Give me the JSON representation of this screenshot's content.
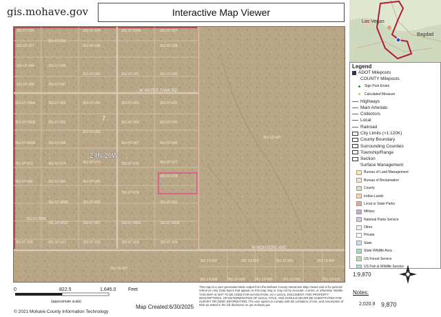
{
  "header": {
    "site": "gis.mohave.gov",
    "title": "Interactive Map Viewer"
  },
  "inset": {
    "city_label": "Las Vegas",
    "town_label": "Bagdad"
  },
  "map": {
    "township": "24N 20W",
    "roads": {
      "water_tank": "W WATER TANK RD",
      "montere": "W MONTERE AVE"
    },
    "parcels": [
      "351-07-024",
      "351-07-028",
      "351-07-028A",
      "351-07-027",
      "351-07-037",
      "351-07-036",
      "351-07-038",
      "351-07-039",
      "351-07-044",
      "351-07-045",
      "351-07-042",
      "351-07-041",
      "351-07-040",
      "351-07-046",
      "351-07-047",
      "351-07-056A",
      "351-07-055",
      "351-07-054",
      "351-07-053",
      "351-07-052",
      "351-07-056B",
      "351-07-062",
      "351-07-063",
      "351-07-064",
      "351-07-065",
      "351-07-069A",
      "351-07-068",
      "351-07-067",
      "351-07-066",
      "351-07-073",
      "351-07-074",
      "351-07-075",
      "351-07-076",
      "351-07-077",
      "351-07-082",
      "351-07-081",
      "351-07-080",
      "351-07-079",
      "351-07-078",
      "351-07-089B",
      "351-07-090",
      "351-07-091",
      "351-07-089A",
      "351-07-089C",
      "351-07-091",
      "351-07-092A",
      "351-07-092B",
      "351-07-100",
      "351-07-101",
      "351-07-102",
      "351-07-103",
      "351-07-104",
      "351-03-007",
      "351-03-007",
      "351-13-007",
      "351-13-008",
      "351-13-009",
      "351-13-001",
      "351-13-004",
      "351-13-006",
      "351-13-005",
      "351-13-003",
      "351-13-010"
    ],
    "lot_number": "7"
  },
  "legend": {
    "title": "Legend",
    "rows": [
      {
        "label": "ADOT Mileposts",
        "kind": "box-dark"
      },
      {
        "label": "COUNTY Mileposts",
        "kind": "none"
      },
      {
        "label": "Sign Post Exists",
        "kind": "dot",
        "color": "#3a8a3a",
        "small": true
      },
      {
        "label": "Calculated Measure",
        "kind": "dot",
        "color": "#d6c24a",
        "small": true
      },
      {
        "label": "Highways",
        "kind": "line"
      },
      {
        "label": "Main Arterials",
        "kind": "line"
      },
      {
        "label": "Collectors",
        "kind": "line"
      },
      {
        "label": "Local",
        "kind": "line"
      },
      {
        "label": "Railroad",
        "kind": "line"
      },
      {
        "label": "City Limits (>1:120K)",
        "kind": "box"
      },
      {
        "label": "County Boundary",
        "kind": "box"
      },
      {
        "label": "Surrounding Counties",
        "kind": "box"
      },
      {
        "label": "Township/Range",
        "kind": "box"
      },
      {
        "label": "Section",
        "kind": "box"
      },
      {
        "label": "Surface Management",
        "kind": "none"
      },
      {
        "label": "Bureau of Land Management",
        "kind": "fill",
        "color": "#f7eab0",
        "small": true
      },
      {
        "label": "Bureau of Reclamation",
        "kind": "fill",
        "color": "#fbe3c6",
        "small": true
      },
      {
        "label": "County",
        "kind": "fill",
        "color": "#c9e6c0",
        "small": true
      },
      {
        "label": "Indian Lands",
        "kind": "fill",
        "color": "#f2d6b0",
        "small": true
      },
      {
        "label": "Local or State Parks",
        "kind": "fill",
        "color": "#e5a8a0",
        "small": true
      },
      {
        "label": "Military",
        "kind": "fill",
        "color": "#caa8d8",
        "small": true
      },
      {
        "label": "National Parks Service",
        "kind": "fill",
        "color": "#d9c2e8",
        "small": true
      },
      {
        "label": "Other",
        "kind": "fill",
        "color": "#eeeeee",
        "small": true
      },
      {
        "label": "Private",
        "kind": "fill",
        "color": "#ffffff",
        "small": true
      },
      {
        "label": "State",
        "kind": "fill",
        "color": "#c8e0f0",
        "small": true
      },
      {
        "label": "State Wildlife Area",
        "kind": "fill",
        "color": "#a8d8c8",
        "small": true
      },
      {
        "label": "US Forest Service",
        "kind": "fill",
        "color": "#b6e0b0",
        "small": true
      },
      {
        "label": "US Fish & Wildlife Service",
        "kind": "fill",
        "color": "#a9d9e0",
        "small": true
      }
    ]
  },
  "scale": {
    "ratio": "1:9,870",
    "ticks": [
      "0",
      "822.5",
      "1,645.0"
    ],
    "unit": "Feet",
    "approx": "(approximate scale)"
  },
  "footer": {
    "copyright": "© 2021 Mohave County Information Technology",
    "created": "Map Created:6/30/2025",
    "disclaimer": "This map is a user generated static output from the Mohave County Interactive Map Viewer and is for general reference only. Data layers that appear on this map may or may not be accurate, current, or otherwise reliable. THIS MAP IS NOT TO BE USED FOR NAVIGATION. AS A LEGAL DOCUMENT, FOR PROPERTY DESCRIPTIONS, OR DETERMINATION OF LEGAL TITLE, AND SHOULD NEVER BE SUBSTITUTED FOR SURVEY OR DEED INFORMATION. The user agrees to comply with the Limitation of Use, and Assumption of Risk as stated in the full disclaimer at: gis.mohave.gov"
  },
  "notes": {
    "label": "Notes:",
    "value1": "2,020.9",
    "value2": "9,870"
  }
}
